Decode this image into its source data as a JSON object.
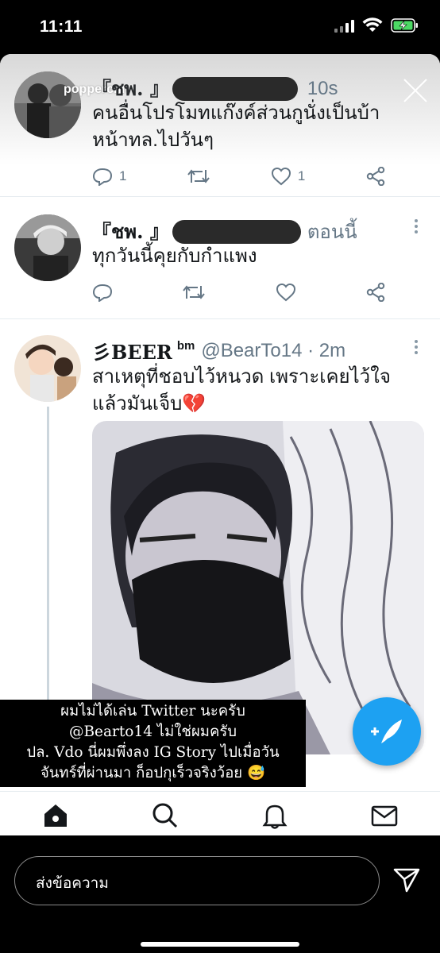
{
  "status_bar": {
    "time": "11:11"
  },
  "story": {
    "username": "poppercnn",
    "tweets": [
      {
        "name": "『ชพ. 』",
        "time": "10s",
        "text_lines": [
          "คนอื่นโปรโมทแก๊งค์ส่วนกูนั่งเป็นบ้า",
          "หน้าทล.ไปวันๆ"
        ],
        "reply_count": "1",
        "like_count": "1"
      },
      {
        "name": "『ชพ. 』",
        "time": "ตอนนี้",
        "text_lines": [
          "ทุกวันนี้คุยกับกำแพง"
        ],
        "reply_count": "",
        "like_count": ""
      },
      {
        "name": "彡BEER",
        "name_suffix": "bm",
        "handle": "@BearTo14 · 2m",
        "text_lines": [
          "สาเหตุที่ชอบไว้หนวด เพราะเคยไว้ใจ",
          "แล้วมันเจ็บ💔"
        ]
      }
    ],
    "caption_lines": [
      "ผมไม่ได้เล่น Twitter นะครับ",
      "@Bearto14 ไม่ใช่ผมครับ",
      "ปล. Vdo นี่ผมพึ่งลง IG Story ไปเมื่อวัน",
      "จันทร์ที่ผ่านมา ก็อปกุเร็วจริงว้อย 😅"
    ],
    "tabs": [
      "home-icon",
      "search-icon",
      "bell-icon",
      "mail-icon"
    ]
  },
  "reply_bar": {
    "placeholder": "ส่งข้อความ"
  }
}
